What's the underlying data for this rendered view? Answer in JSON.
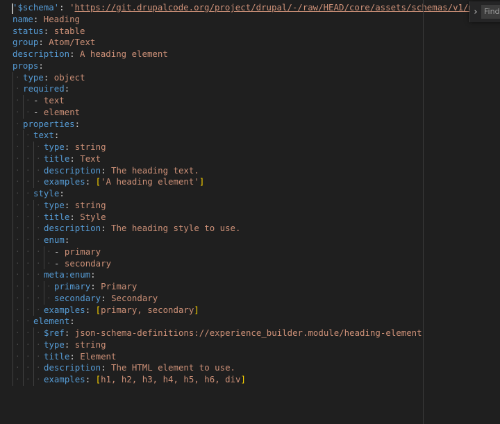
{
  "editor": {
    "lines": [
      {
        "indent": 0,
        "tokens": [
          {
            "t": "'$schema'",
            "c": "key"
          },
          {
            "t": ": ",
            "c": "punct"
          },
          {
            "t": "'",
            "c": "str"
          },
          {
            "t": "https://git.drupalcode.org/project/drupal/-/raw/HEAD/core/assets/schemas/v1/m",
            "c": "link"
          }
        ]
      },
      {
        "indent": 0,
        "tokens": [
          {
            "t": "name",
            "c": "key"
          },
          {
            "t": ": ",
            "c": "punct"
          },
          {
            "t": "Heading",
            "c": "str"
          }
        ]
      },
      {
        "indent": 0,
        "tokens": [
          {
            "t": "status",
            "c": "key"
          },
          {
            "t": ": ",
            "c": "punct"
          },
          {
            "t": "stable",
            "c": "str"
          }
        ]
      },
      {
        "indent": 0,
        "tokens": [
          {
            "t": "group",
            "c": "key"
          },
          {
            "t": ": ",
            "c": "punct"
          },
          {
            "t": "Atom/Text",
            "c": "str"
          }
        ]
      },
      {
        "indent": 0,
        "tokens": [
          {
            "t": "description",
            "c": "key"
          },
          {
            "t": ": ",
            "c": "punct"
          },
          {
            "t": "A heading element",
            "c": "str"
          }
        ]
      },
      {
        "indent": 0,
        "tokens": [
          {
            "t": "props",
            "c": "key"
          },
          {
            "t": ":",
            "c": "punct"
          }
        ]
      },
      {
        "indent": 1,
        "tokens": [
          {
            "t": "type",
            "c": "key"
          },
          {
            "t": ": ",
            "c": "punct"
          },
          {
            "t": "object",
            "c": "str"
          }
        ]
      },
      {
        "indent": 1,
        "tokens": [
          {
            "t": "required",
            "c": "key"
          },
          {
            "t": ":",
            "c": "punct"
          }
        ]
      },
      {
        "indent": 2,
        "tokens": [
          {
            "t": "- ",
            "c": "punct"
          },
          {
            "t": "text",
            "c": "str"
          }
        ]
      },
      {
        "indent": 2,
        "tokens": [
          {
            "t": "- ",
            "c": "punct"
          },
          {
            "t": "element",
            "c": "str"
          }
        ]
      },
      {
        "indent": 1,
        "tokens": [
          {
            "t": "properties",
            "c": "key"
          },
          {
            "t": ":",
            "c": "punct"
          }
        ]
      },
      {
        "indent": 2,
        "tokens": [
          {
            "t": "text",
            "c": "key"
          },
          {
            "t": ":",
            "c": "punct"
          }
        ]
      },
      {
        "indent": 3,
        "tokens": [
          {
            "t": "type",
            "c": "key"
          },
          {
            "t": ": ",
            "c": "punct"
          },
          {
            "t": "string",
            "c": "str"
          }
        ]
      },
      {
        "indent": 3,
        "tokens": [
          {
            "t": "title",
            "c": "key"
          },
          {
            "t": ": ",
            "c": "punct"
          },
          {
            "t": "Text",
            "c": "str"
          }
        ]
      },
      {
        "indent": 3,
        "tokens": [
          {
            "t": "description",
            "c": "key"
          },
          {
            "t": ": ",
            "c": "punct"
          },
          {
            "t": "The heading text.",
            "c": "str"
          }
        ]
      },
      {
        "indent": 3,
        "tokens": [
          {
            "t": "examples",
            "c": "key"
          },
          {
            "t": ": ",
            "c": "punct"
          },
          {
            "t": "[",
            "c": "bracket"
          },
          {
            "t": "'A heading element'",
            "c": "str"
          },
          {
            "t": "]",
            "c": "bracket"
          }
        ]
      },
      {
        "indent": 2,
        "tokens": [
          {
            "t": "style",
            "c": "key"
          },
          {
            "t": ":",
            "c": "punct"
          }
        ]
      },
      {
        "indent": 3,
        "tokens": [
          {
            "t": "type",
            "c": "key"
          },
          {
            "t": ": ",
            "c": "punct"
          },
          {
            "t": "string",
            "c": "str"
          }
        ]
      },
      {
        "indent": 3,
        "tokens": [
          {
            "t": "title",
            "c": "key"
          },
          {
            "t": ": ",
            "c": "punct"
          },
          {
            "t": "Style",
            "c": "str"
          }
        ]
      },
      {
        "indent": 3,
        "tokens": [
          {
            "t": "description",
            "c": "key"
          },
          {
            "t": ": ",
            "c": "punct"
          },
          {
            "t": "The heading style to use.",
            "c": "str"
          }
        ]
      },
      {
        "indent": 3,
        "tokens": [
          {
            "t": "enum",
            "c": "key"
          },
          {
            "t": ":",
            "c": "punct"
          }
        ]
      },
      {
        "indent": 4,
        "tokens": [
          {
            "t": "- ",
            "c": "punct"
          },
          {
            "t": "primary",
            "c": "str"
          }
        ]
      },
      {
        "indent": 4,
        "tokens": [
          {
            "t": "- ",
            "c": "punct"
          },
          {
            "t": "secondary",
            "c": "str"
          }
        ]
      },
      {
        "indent": 3,
        "tokens": [
          {
            "t": "meta:enum",
            "c": "key"
          },
          {
            "t": ":",
            "c": "punct"
          }
        ]
      },
      {
        "indent": 4,
        "tokens": [
          {
            "t": "primary",
            "c": "key"
          },
          {
            "t": ": ",
            "c": "punct"
          },
          {
            "t": "Primary",
            "c": "str"
          }
        ]
      },
      {
        "indent": 4,
        "tokens": [
          {
            "t": "secondary",
            "c": "key"
          },
          {
            "t": ": ",
            "c": "punct"
          },
          {
            "t": "Secondary",
            "c": "str"
          }
        ]
      },
      {
        "indent": 3,
        "tokens": [
          {
            "t": "examples",
            "c": "key"
          },
          {
            "t": ": ",
            "c": "punct"
          },
          {
            "t": "[",
            "c": "bracket"
          },
          {
            "t": "primary, secondary",
            "c": "str"
          },
          {
            "t": "]",
            "c": "bracket"
          }
        ]
      },
      {
        "indent": 2,
        "tokens": [
          {
            "t": "element",
            "c": "key"
          },
          {
            "t": ":",
            "c": "punct"
          }
        ]
      },
      {
        "indent": 3,
        "tokens": [
          {
            "t": "$ref",
            "c": "key"
          },
          {
            "t": ": ",
            "c": "punct"
          },
          {
            "t": "json-schema-definitions://experience_builder.module/heading-element",
            "c": "str"
          }
        ]
      },
      {
        "indent": 3,
        "tokens": [
          {
            "t": "type",
            "c": "key"
          },
          {
            "t": ": ",
            "c": "punct"
          },
          {
            "t": "string",
            "c": "str"
          }
        ]
      },
      {
        "indent": 3,
        "tokens": [
          {
            "t": "title",
            "c": "key"
          },
          {
            "t": ": ",
            "c": "punct"
          },
          {
            "t": "Element",
            "c": "str"
          }
        ]
      },
      {
        "indent": 3,
        "tokens": [
          {
            "t": "description",
            "c": "key"
          },
          {
            "t": ": ",
            "c": "punct"
          },
          {
            "t": "The HTML element to use.",
            "c": "str"
          }
        ]
      },
      {
        "indent": 3,
        "tokens": [
          {
            "t": "examples",
            "c": "key"
          },
          {
            "t": ": ",
            "c": "punct"
          },
          {
            "t": "[",
            "c": "bracket"
          },
          {
            "t": "h1, h2, h3, h4, h5, h6, div",
            "c": "str"
          },
          {
            "t": "]",
            "c": "bracket"
          }
        ]
      }
    ]
  },
  "find_widget": {
    "toggle_icon": "chevron-right-icon",
    "toggle_glyph": "›",
    "input_placeholder": "Find"
  },
  "colors": {
    "background": "#1f1f1f",
    "key": "#569cd6",
    "string": "#ce9178",
    "bracket": "#ffd700"
  }
}
